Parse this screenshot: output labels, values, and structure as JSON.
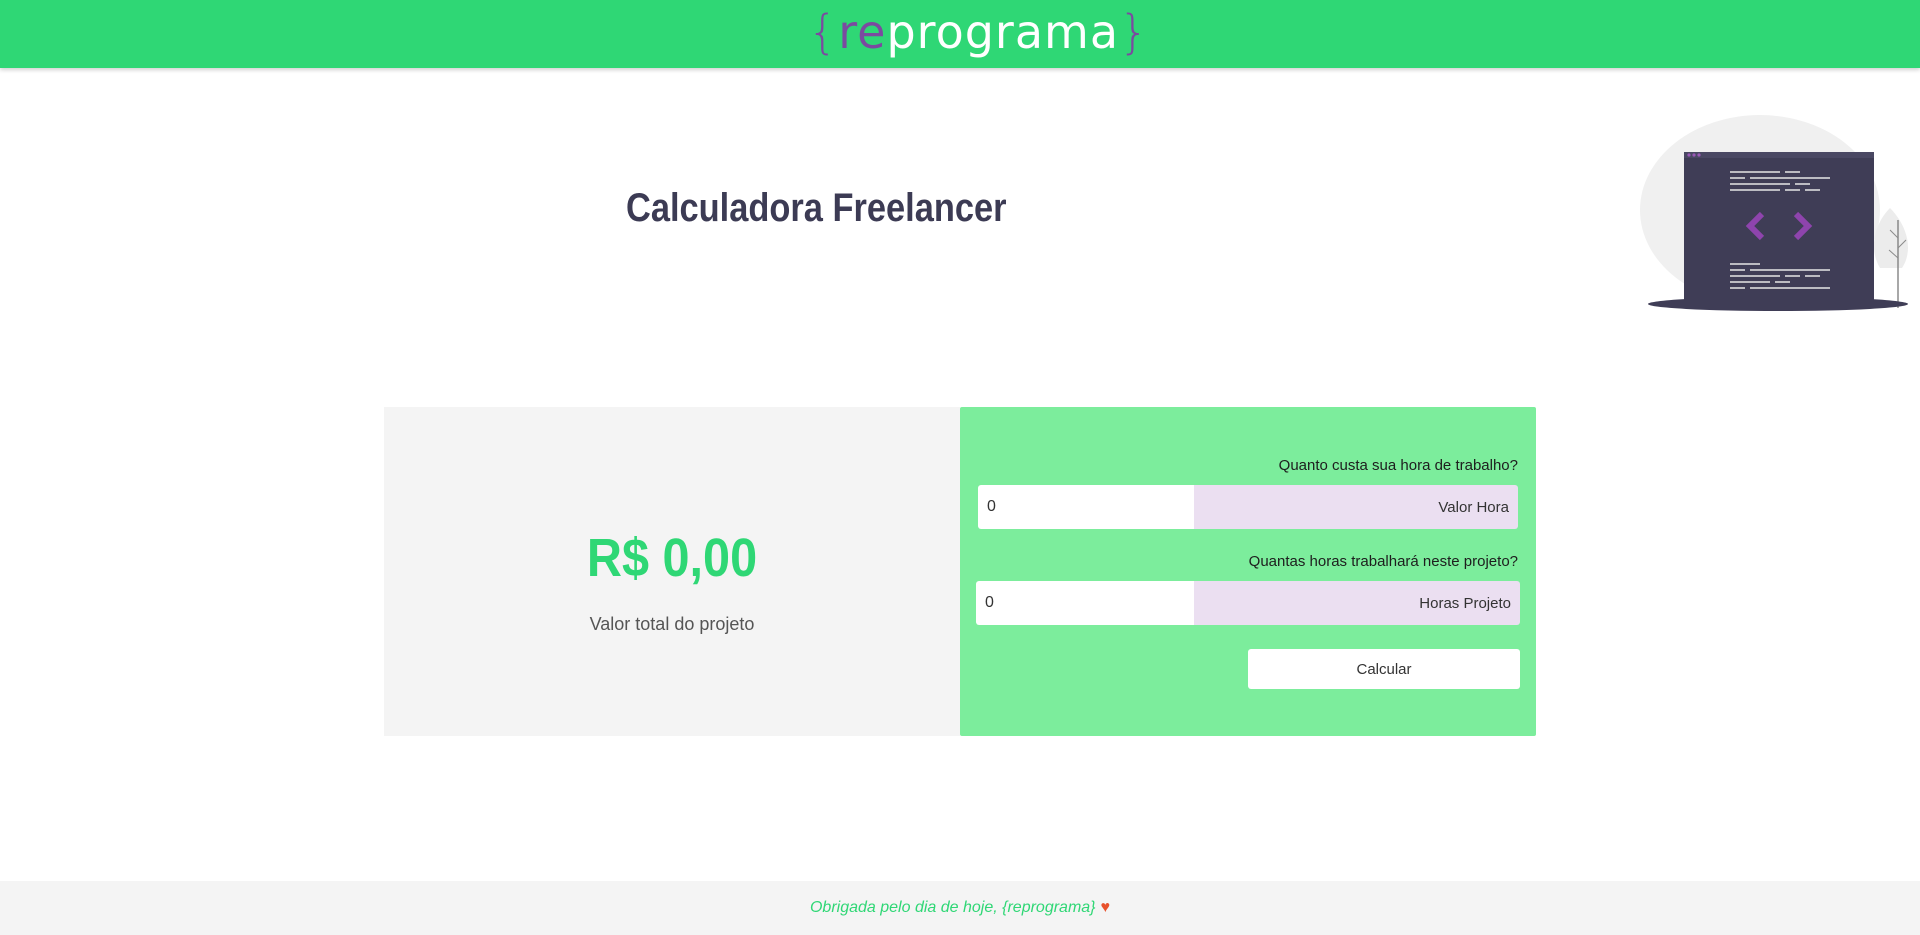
{
  "header": {
    "logo": {
      "open_brace": "{",
      "re": "re",
      "programa": "programa",
      "close_brace": "}"
    }
  },
  "main": {
    "title": "Calculadora Freelancer",
    "illustration_icon": "code-laptop-illustration"
  },
  "result": {
    "value": "R$ 0,00",
    "label": "Valor total do projeto"
  },
  "form": {
    "hour_question": "Quanto custa sua hora de trabalho?",
    "hour_value": "0",
    "hour_suffix": "Valor Hora",
    "hours_question": "Quantas horas trabalhará neste projeto?",
    "hours_value": "0",
    "hours_suffix": "Horas Projeto",
    "submit_label": "Calcular"
  },
  "footer": {
    "text": "Obrigada pelo dia de hoje, {reprograma}",
    "heart": "♥"
  },
  "colors": {
    "brand_green": "#2fd775",
    "form_green": "#7ced9c",
    "brand_purple": "#7b4aa0",
    "suffix_bg": "#ebdff1",
    "heart": "#e8512c"
  }
}
